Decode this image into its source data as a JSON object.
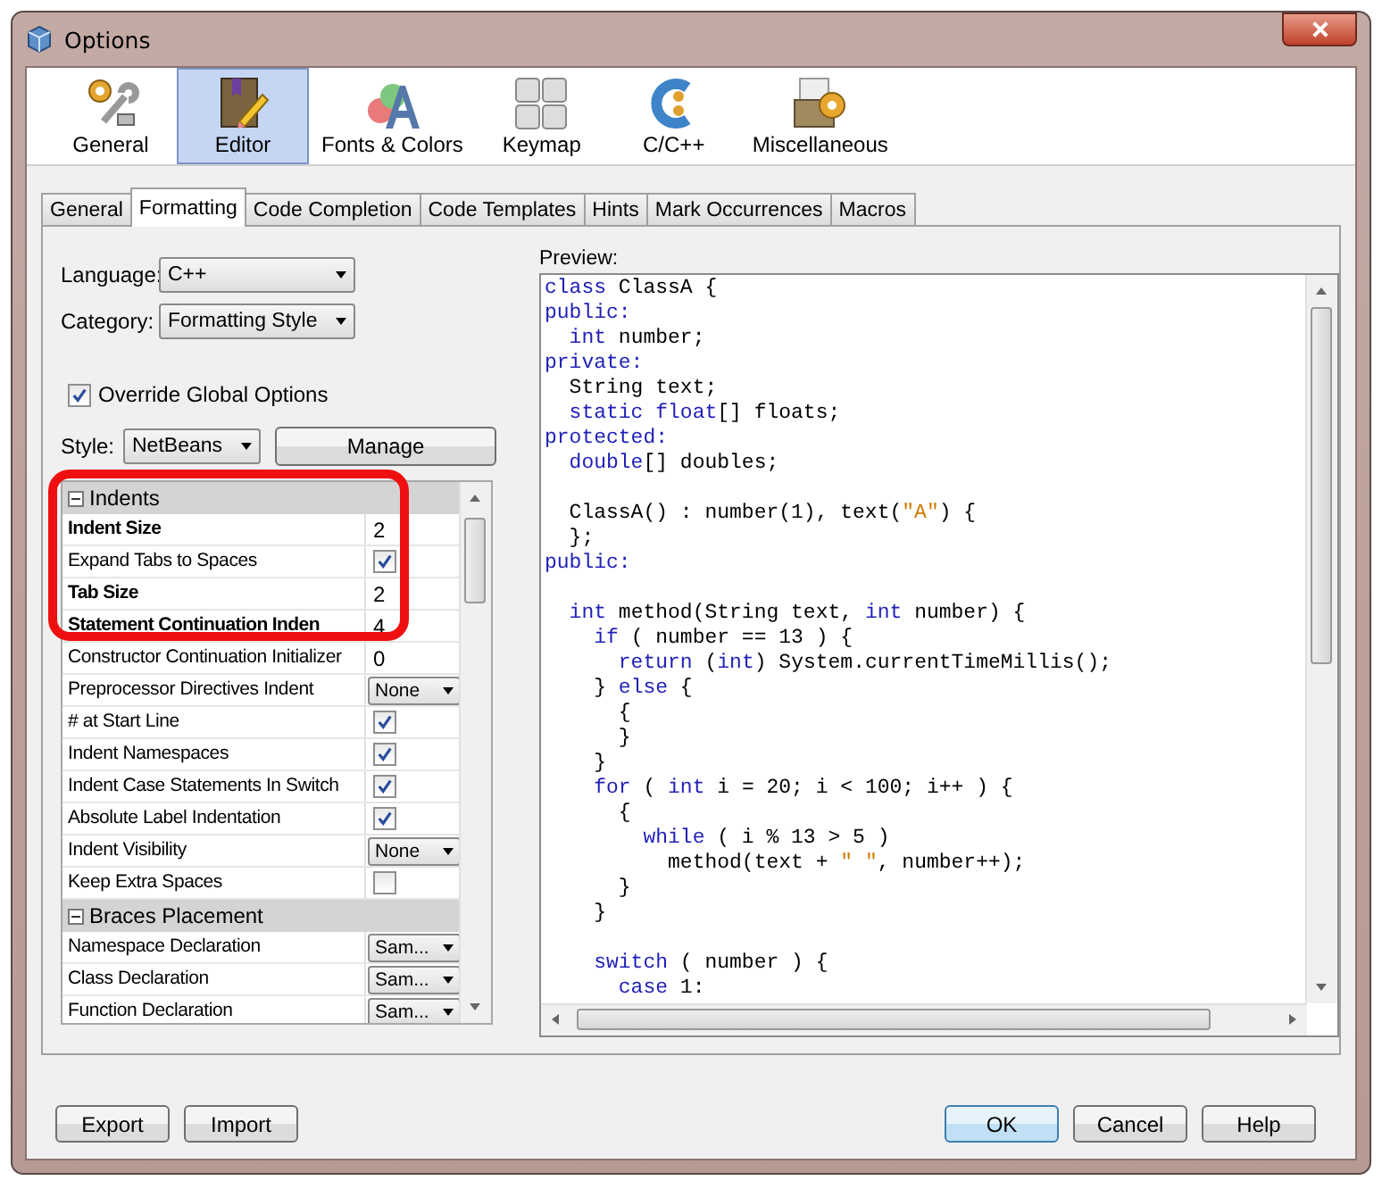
{
  "window": {
    "title": "Options"
  },
  "categories": [
    {
      "label": "General",
      "kind": "general",
      "selected": false
    },
    {
      "label": "Editor",
      "kind": "editor",
      "selected": true
    },
    {
      "label": "Fonts & Colors",
      "kind": "fonts",
      "selected": false
    },
    {
      "label": "Keymap",
      "kind": "keymap",
      "selected": false
    },
    {
      "label": "C/C++",
      "kind": "cpp",
      "selected": false
    },
    {
      "label": "Miscellaneous",
      "kind": "misc",
      "selected": false
    }
  ],
  "tabs": [
    {
      "label": "General",
      "selected": false
    },
    {
      "label": "Formatting",
      "selected": true
    },
    {
      "label": "Code Completion",
      "selected": false
    },
    {
      "label": "Code Templates",
      "selected": false
    },
    {
      "label": "Hints",
      "selected": false
    },
    {
      "label": "Mark Occurrences",
      "selected": false
    },
    {
      "label": "Macros",
      "selected": false
    }
  ],
  "language": {
    "label": "Language:",
    "value": "C++"
  },
  "category": {
    "label": "Category:",
    "value": "Formatting Style"
  },
  "override": {
    "label": "Override Global Options",
    "checked": true
  },
  "style": {
    "label": "Style:",
    "value": "NetBeans"
  },
  "manage_button": "Manage",
  "properties": [
    {
      "title": "Indents",
      "expanded": true,
      "rows": [
        {
          "name": "Indent Size",
          "bold": true,
          "kind": "text",
          "value": "2"
        },
        {
          "name": "Expand Tabs to Spaces",
          "bold": false,
          "kind": "checkbox",
          "checked": true
        },
        {
          "name": "Tab Size",
          "bold": true,
          "kind": "text",
          "value": "2"
        },
        {
          "name": "Statement Continuation Inden",
          "bold": true,
          "kind": "text",
          "value": "4"
        },
        {
          "name": "Constructor Continuation Initializer",
          "bold": false,
          "kind": "text",
          "value": "0"
        },
        {
          "name": "Preprocessor Directives Indent",
          "bold": false,
          "kind": "dropdown",
          "value": "None"
        },
        {
          "name": "# at Start Line",
          "bold": false,
          "kind": "checkbox",
          "checked": true
        },
        {
          "name": "Indent Namespaces",
          "bold": false,
          "kind": "checkbox",
          "checked": true
        },
        {
          "name": "Indent Case Statements In Switch",
          "bold": false,
          "kind": "checkbox",
          "checked": true
        },
        {
          "name": "Absolute Label Indentation",
          "bold": false,
          "kind": "checkbox",
          "checked": true
        },
        {
          "name": "Indent Visibility",
          "bold": false,
          "kind": "dropdown",
          "value": "None"
        },
        {
          "name": "Keep Extra Spaces",
          "bold": false,
          "kind": "checkbox",
          "checked": false
        }
      ]
    },
    {
      "title": "Braces Placement",
      "expanded": true,
      "rows": [
        {
          "name": "Namespace Declaration",
          "bold": false,
          "kind": "dropdown",
          "value": "Sam..."
        },
        {
          "name": "Class Declaration",
          "bold": false,
          "kind": "dropdown",
          "value": "Sam..."
        },
        {
          "name": "Function Declaration",
          "bold": false,
          "kind": "dropdown",
          "value": "Sam..."
        }
      ]
    }
  ],
  "preview": {
    "label": "Preview:",
    "lines": [
      {
        "blank_before": false,
        "tokens": [
          {
            "text": "class",
            "kind": "keyword"
          },
          {
            "text": " ClassA {",
            "kind": "plain"
          }
        ]
      },
      {
        "blank_before": false,
        "tokens": [
          {
            "text": "public:",
            "kind": "keyword"
          }
        ]
      },
      {
        "blank_before": false,
        "tokens": [
          {
            "text": "  int",
            "kind": "keyword"
          },
          {
            "text": " number;",
            "kind": "plain"
          }
        ]
      },
      {
        "blank_before": false,
        "tokens": [
          {
            "text": "private:",
            "kind": "keyword"
          }
        ]
      },
      {
        "blank_before": false,
        "tokens": [
          {
            "text": "  String text;",
            "kind": "plain"
          }
        ]
      },
      {
        "blank_before": false,
        "tokens": [
          {
            "text": "  static float",
            "kind": "keyword"
          },
          {
            "text": "[] floats;",
            "kind": "plain"
          }
        ]
      },
      {
        "blank_before": false,
        "tokens": [
          {
            "text": "protected:",
            "kind": "keyword"
          }
        ]
      },
      {
        "blank_before": false,
        "tokens": [
          {
            "text": "  double",
            "kind": "keyword"
          },
          {
            "text": "[] doubles;",
            "kind": "plain"
          }
        ]
      },
      {
        "blank_before": true,
        "tokens": [
          {
            "text": "  ClassA() : number(1), text(",
            "kind": "plain"
          },
          {
            "text": "\"A\"",
            "kind": "string"
          },
          {
            "text": ") {",
            "kind": "plain"
          }
        ]
      },
      {
        "blank_before": false,
        "tokens": [
          {
            "text": "  };",
            "kind": "plain"
          }
        ]
      },
      {
        "blank_before": false,
        "tokens": [
          {
            "text": "public:",
            "kind": "keyword"
          }
        ]
      },
      {
        "blank_before": true,
        "tokens": [
          {
            "text": "  int",
            "kind": "keyword"
          },
          {
            "text": " method(String text, ",
            "kind": "plain"
          },
          {
            "text": "int",
            "kind": "keyword"
          },
          {
            "text": " number) {",
            "kind": "plain"
          }
        ]
      },
      {
        "blank_before": false,
        "tokens": [
          {
            "text": "    if",
            "kind": "keyword"
          },
          {
            "text": " ( number == 13 ) {",
            "kind": "plain"
          }
        ]
      },
      {
        "blank_before": false,
        "tokens": [
          {
            "text": "      return",
            "kind": "keyword"
          },
          {
            "text": " (",
            "kind": "plain"
          },
          {
            "text": "int",
            "kind": "keyword"
          },
          {
            "text": ") System.currentTimeMillis();",
            "kind": "plain"
          }
        ]
      },
      {
        "blank_before": false,
        "tokens": [
          {
            "text": "    } ",
            "kind": "plain"
          },
          {
            "text": "else",
            "kind": "keyword"
          },
          {
            "text": " {",
            "kind": "plain"
          }
        ]
      },
      {
        "blank_before": false,
        "tokens": [
          {
            "text": "      {",
            "kind": "plain"
          }
        ]
      },
      {
        "blank_before": false,
        "tokens": [
          {
            "text": "      }",
            "kind": "plain"
          }
        ]
      },
      {
        "blank_before": false,
        "tokens": [
          {
            "text": "    }",
            "kind": "plain"
          }
        ]
      },
      {
        "blank_before": false,
        "tokens": [
          {
            "text": "    for",
            "kind": "keyword"
          },
          {
            "text": " ( ",
            "kind": "plain"
          },
          {
            "text": "int",
            "kind": "keyword"
          },
          {
            "text": " i = 20; i < 100; i++ ) {",
            "kind": "plain"
          }
        ]
      },
      {
        "blank_before": false,
        "tokens": [
          {
            "text": "      {",
            "kind": "plain"
          }
        ]
      },
      {
        "blank_before": false,
        "tokens": [
          {
            "text": "        while",
            "kind": "keyword"
          },
          {
            "text": " ( i % 13 > 5 )",
            "kind": "plain"
          }
        ]
      },
      {
        "blank_before": false,
        "tokens": [
          {
            "text": "          method(text + ",
            "kind": "plain"
          },
          {
            "text": "\" \"",
            "kind": "string"
          },
          {
            "text": ", number++);",
            "kind": "plain"
          }
        ]
      },
      {
        "blank_before": false,
        "tokens": [
          {
            "text": "      }",
            "kind": "plain"
          }
        ]
      },
      {
        "blank_before": false,
        "tokens": [
          {
            "text": "    }",
            "kind": "plain"
          }
        ]
      },
      {
        "blank_before": true,
        "tokens": [
          {
            "text": "    switch",
            "kind": "keyword"
          },
          {
            "text": " ( number ) {",
            "kind": "plain"
          }
        ]
      },
      {
        "blank_before": false,
        "tokens": [
          {
            "text": "      case",
            "kind": "keyword"
          },
          {
            "text": " 1:",
            "kind": "plain"
          }
        ]
      }
    ]
  },
  "buttons_left": [
    "Export",
    "Import"
  ],
  "buttons_right": [
    {
      "label": "OK",
      "kind": "default"
    },
    {
      "label": "Cancel",
      "kind": "normal"
    },
    {
      "label": "Help",
      "kind": "normal"
    }
  ]
}
